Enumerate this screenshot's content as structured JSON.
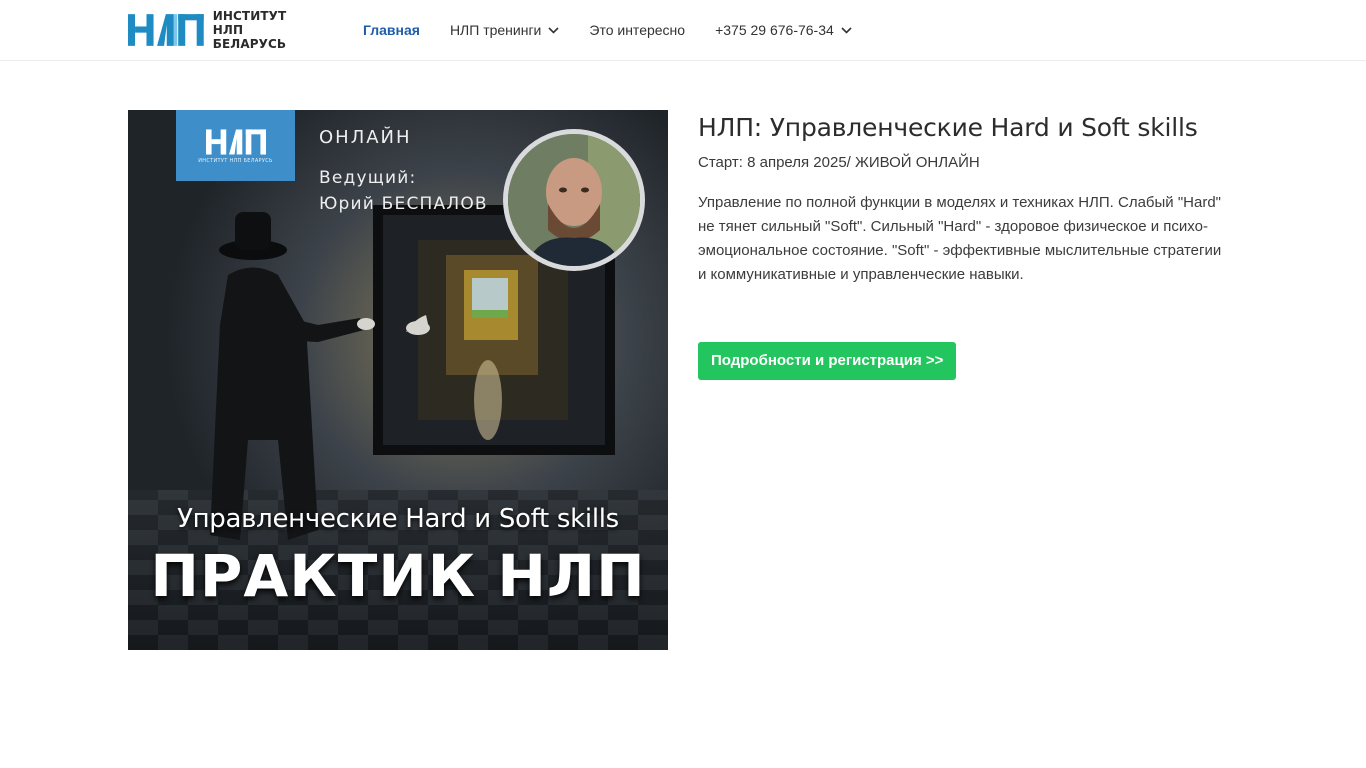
{
  "header": {
    "logo": {
      "mark": "НЛП",
      "line1": "ИНСТИТУТ НЛП",
      "line2": "БЕЛАРУСЬ"
    },
    "nav": [
      {
        "label": "Главная",
        "active": true,
        "dropdown": false
      },
      {
        "label": "НЛП тренинги",
        "active": false,
        "dropdown": true
      },
      {
        "label": "Это интересно",
        "active": false,
        "dropdown": false
      },
      {
        "label": "+375 29 676-76-34",
        "active": false,
        "dropdown": true
      }
    ]
  },
  "banner": {
    "badge_mark": "НЛП",
    "badge_sub": "ИНСТИТУТ НЛП БЕЛАРУСЬ",
    "online": "ОНЛАЙН",
    "host_label": "Ведущий:",
    "host_name": "Юрий БЕСПАЛОВ",
    "subtitle": "Управленческие Hard и Soft skills",
    "headline": "ПРАКТИК НЛП"
  },
  "course": {
    "title": "НЛП: Управленческие Hard и Soft skills",
    "start": "Старт: 8 апреля 2025/ ЖИВОЙ ОНЛАЙН",
    "description": "Управление по полной функции в моделях и техниках НЛП. Слабый \"Hard\" не тянет сильный \"Soft\".  Сильный \"Hard\" - здоровое физическое и психо-эмоциональное состояние. \"Soft\" - эффективные мыслительные стратегии и коммуникативные и управленческие навыки.",
    "cta_label": "Подробности и регистрация >>"
  },
  "colors": {
    "brand_blue": "#1e8bc3",
    "nav_active": "#1f5dab",
    "cta_green": "#22c55e",
    "badge_blue": "#3d8ec9"
  },
  "icons": [
    "chevron-down-icon"
  ]
}
